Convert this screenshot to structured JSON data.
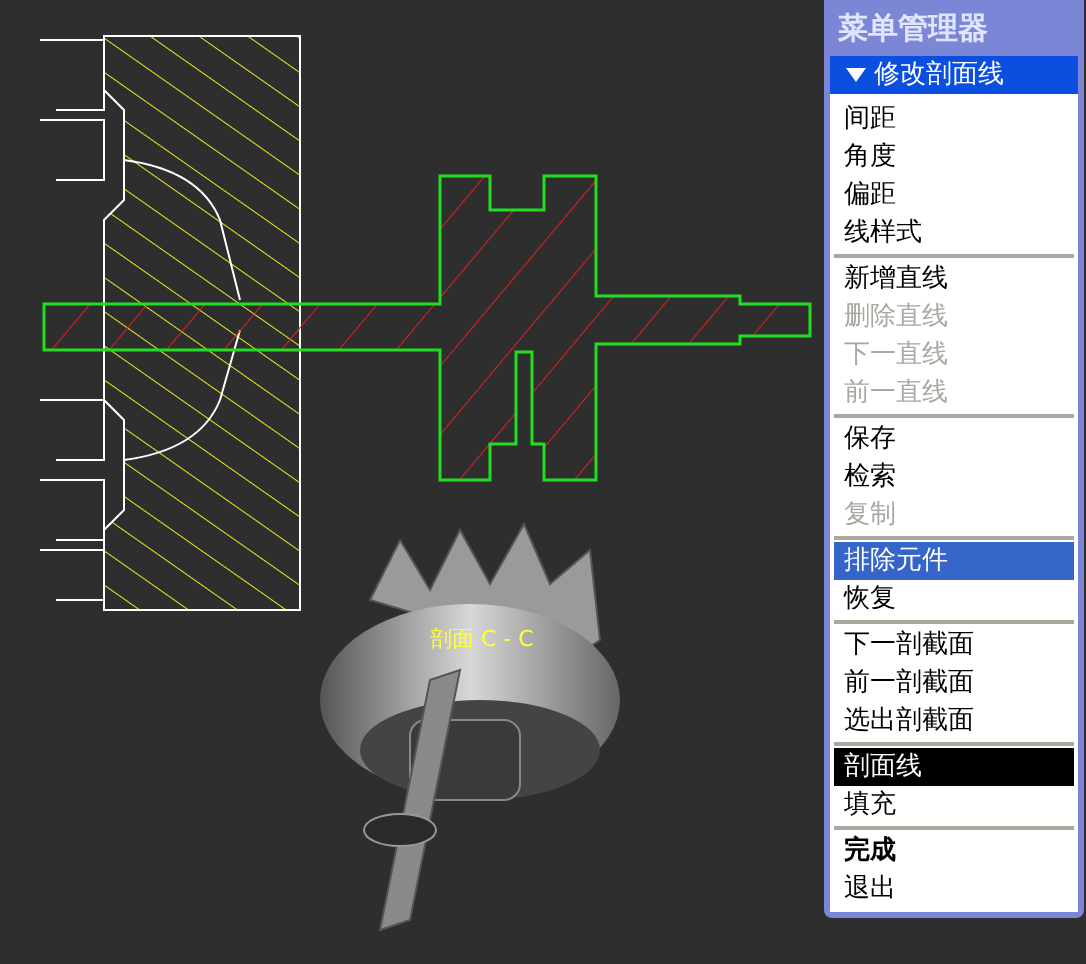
{
  "viewport": {
    "section_label": "剖面 C - C"
  },
  "menu_manager": {
    "title": "菜单管理器",
    "header": {
      "label": "修改剖面线",
      "expanded": true
    },
    "groups": [
      [
        {
          "label": "间距",
          "disabled": false,
          "selected": false,
          "highlighted": false
        },
        {
          "label": "角度",
          "disabled": false,
          "selected": false,
          "highlighted": false
        },
        {
          "label": "偏距",
          "disabled": false,
          "selected": false,
          "highlighted": false
        },
        {
          "label": "线样式",
          "disabled": false,
          "selected": false,
          "highlighted": false
        }
      ],
      [
        {
          "label": "新增直线",
          "disabled": false,
          "selected": false,
          "highlighted": false
        },
        {
          "label": "删除直线",
          "disabled": true,
          "selected": false,
          "highlighted": false
        },
        {
          "label": "下一直线",
          "disabled": true,
          "selected": false,
          "highlighted": false
        },
        {
          "label": "前一直线",
          "disabled": true,
          "selected": false,
          "highlighted": false
        }
      ],
      [
        {
          "label": "保存",
          "disabled": false,
          "selected": false,
          "highlighted": false
        },
        {
          "label": "检索",
          "disabled": false,
          "selected": false,
          "highlighted": false
        },
        {
          "label": "复制",
          "disabled": true,
          "selected": false,
          "highlighted": false
        }
      ],
      [
        {
          "label": "排除元件",
          "disabled": false,
          "selected": false,
          "highlighted": true
        },
        {
          "label": "恢复",
          "disabled": false,
          "selected": false,
          "highlighted": false
        }
      ],
      [
        {
          "label": "下一剖截面",
          "disabled": false,
          "selected": false,
          "highlighted": false
        },
        {
          "label": "前一剖截面",
          "disabled": false,
          "selected": false,
          "highlighted": false
        },
        {
          "label": "选出剖截面",
          "disabled": false,
          "selected": false,
          "highlighted": false
        }
      ],
      [
        {
          "label": "剖面线",
          "disabled": false,
          "selected": true,
          "highlighted": false
        },
        {
          "label": "填充",
          "disabled": false,
          "selected": false,
          "highlighted": false
        }
      ],
      [
        {
          "label": "完成",
          "disabled": false,
          "selected": false,
          "highlighted": false,
          "bold": true
        },
        {
          "label": "退出",
          "disabled": false,
          "selected": false,
          "highlighted": false,
          "bold": false
        }
      ]
    ]
  }
}
